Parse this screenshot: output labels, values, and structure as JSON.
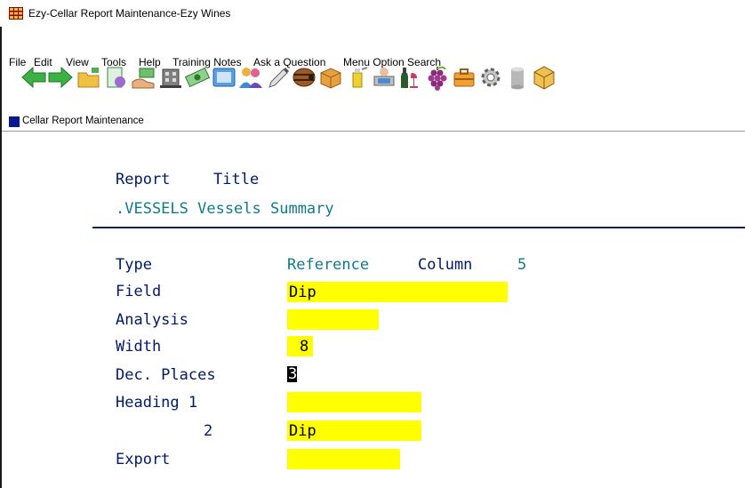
{
  "window": {
    "title": "Ezy-Cellar Report Maintenance-Ezy Wines"
  },
  "menu": [
    "File",
    "Edit",
    "View",
    "Tools",
    "Help",
    "Training Notes",
    "Ask a Question",
    "Menu Option Search"
  ],
  "toolbar_icons": [
    "back-arrow-icon",
    "forward-arrow-icon",
    "open-folder-icon",
    "document-icon",
    "hand-money-icon",
    "building-icon",
    "money-icon",
    "id-card-icon",
    "people-icon",
    "pen-icon",
    "barrel-icon",
    "box-icon",
    "spray-icon",
    "computer-user-icon",
    "wine-bottle-icon",
    "grapes-icon",
    "briefcase-icon",
    "gear-icon",
    "cylinder-icon",
    "cube-icon"
  ],
  "subwindow": {
    "title": "Cellar Report Maintenance"
  },
  "report": {
    "header_report": "Report",
    "header_title": "Title",
    "name": ".VESSELS Vessels Summary"
  },
  "form": {
    "type_label": "Type",
    "type_value": "Reference",
    "column_label": "Column",
    "column_value": "5",
    "field_label": "Field",
    "field_value": "Dip",
    "analysis_label": "Analysis",
    "analysis_value": "",
    "width_label": "Width",
    "width_value": "8",
    "dec_label": "Dec. Places",
    "dec_value": "3",
    "heading1_label": "Heading 1",
    "heading1_value": "",
    "heading2_label": "2",
    "heading2_value": "Dip",
    "export_label": "Export",
    "export_value": ""
  },
  "colors": {
    "label": "#001a66",
    "value": "#117a8b",
    "highlight": "#ffff00",
    "title_square": "#0a1a8a"
  }
}
